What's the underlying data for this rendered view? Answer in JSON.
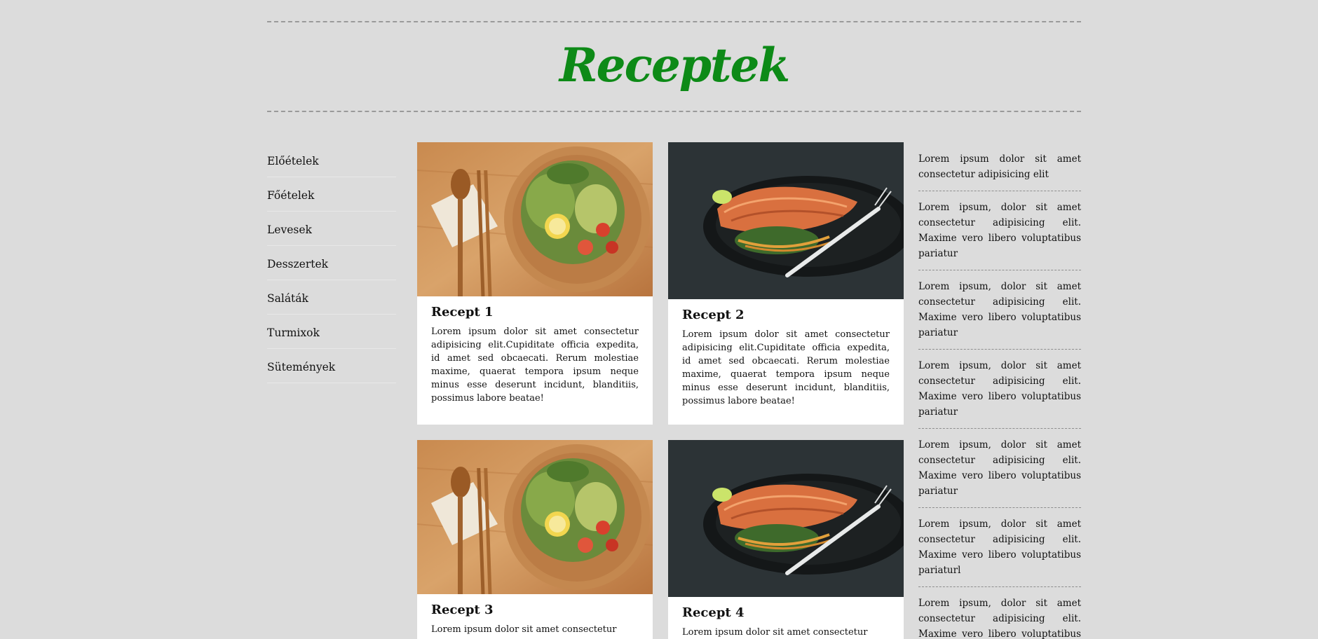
{
  "header": {
    "title": "Receptek"
  },
  "sidebar": {
    "items": [
      {
        "label": "Előételek"
      },
      {
        "label": "Főételek"
      },
      {
        "label": "Levesek"
      },
      {
        "label": "Desszertek"
      },
      {
        "label": "Saláták"
      },
      {
        "label": "Turmixok"
      },
      {
        "label": "Sütemények"
      }
    ]
  },
  "cards": [
    {
      "title": "Recept 1",
      "text": "Lorem ipsum dolor sit amet consectetur adipisicing elit.Cupiditate officia expedita, id amet sed obcaecati. Rerum molestiae maxime, quaerat tempora ipsum neque minus esse deserunt incidunt, blanditiis, possimus labore beatae!",
      "image": "salad-bowl-photo"
    },
    {
      "title": "Recept 2",
      "text": "Lorem ipsum dolor sit amet consectetur adipisicing elit.Cupiditate officia expedita, id amet sed obcaecati. Rerum molestiae maxime, quaerat tempora ipsum neque minus esse deserunt incidunt, blanditiis, possimus labore beatae!",
      "image": "salmon-plate-photo"
    },
    {
      "title": "Recept 3",
      "text": "Lorem ipsum dolor sit amet consectetur",
      "image": "salad-bowl-photo"
    },
    {
      "title": "Recept 4",
      "text": "Lorem ipsum dolor sit amet consectetur",
      "image": "salmon-plate-photo"
    }
  ],
  "aside": {
    "items": [
      {
        "text": "Lorem ipsum dolor sit amet consectetur adipisicing elit"
      },
      {
        "text": "Lorem ipsum, dolor sit amet consectetur adipisicing elit. Maxime vero libero voluptatibus pariatur"
      },
      {
        "text": "Lorem ipsum, dolor sit amet consectetur adipisicing elit. Maxime vero libero voluptatibus pariatur"
      },
      {
        "text": "Lorem ipsum, dolor sit amet consectetur adipisicing elit. Maxime vero libero voluptatibus pariatur"
      },
      {
        "text": "Lorem ipsum, dolor sit amet consectetur adipisicing elit. Maxime vero libero voluptatibus pariatur"
      },
      {
        "text": "Lorem ipsum, dolor sit amet consectetur adipisicing elit. Maxime vero libero voluptatibus pariaturl"
      },
      {
        "text": "Lorem ipsum, dolor sit amet consectetur adipisicing elit. Maxime vero libero voluptatibus pariatur"
      }
    ]
  },
  "colors": {
    "background": "#dcdcdc",
    "title_green": "#0d8a17",
    "card_bg": "#ffffff"
  }
}
